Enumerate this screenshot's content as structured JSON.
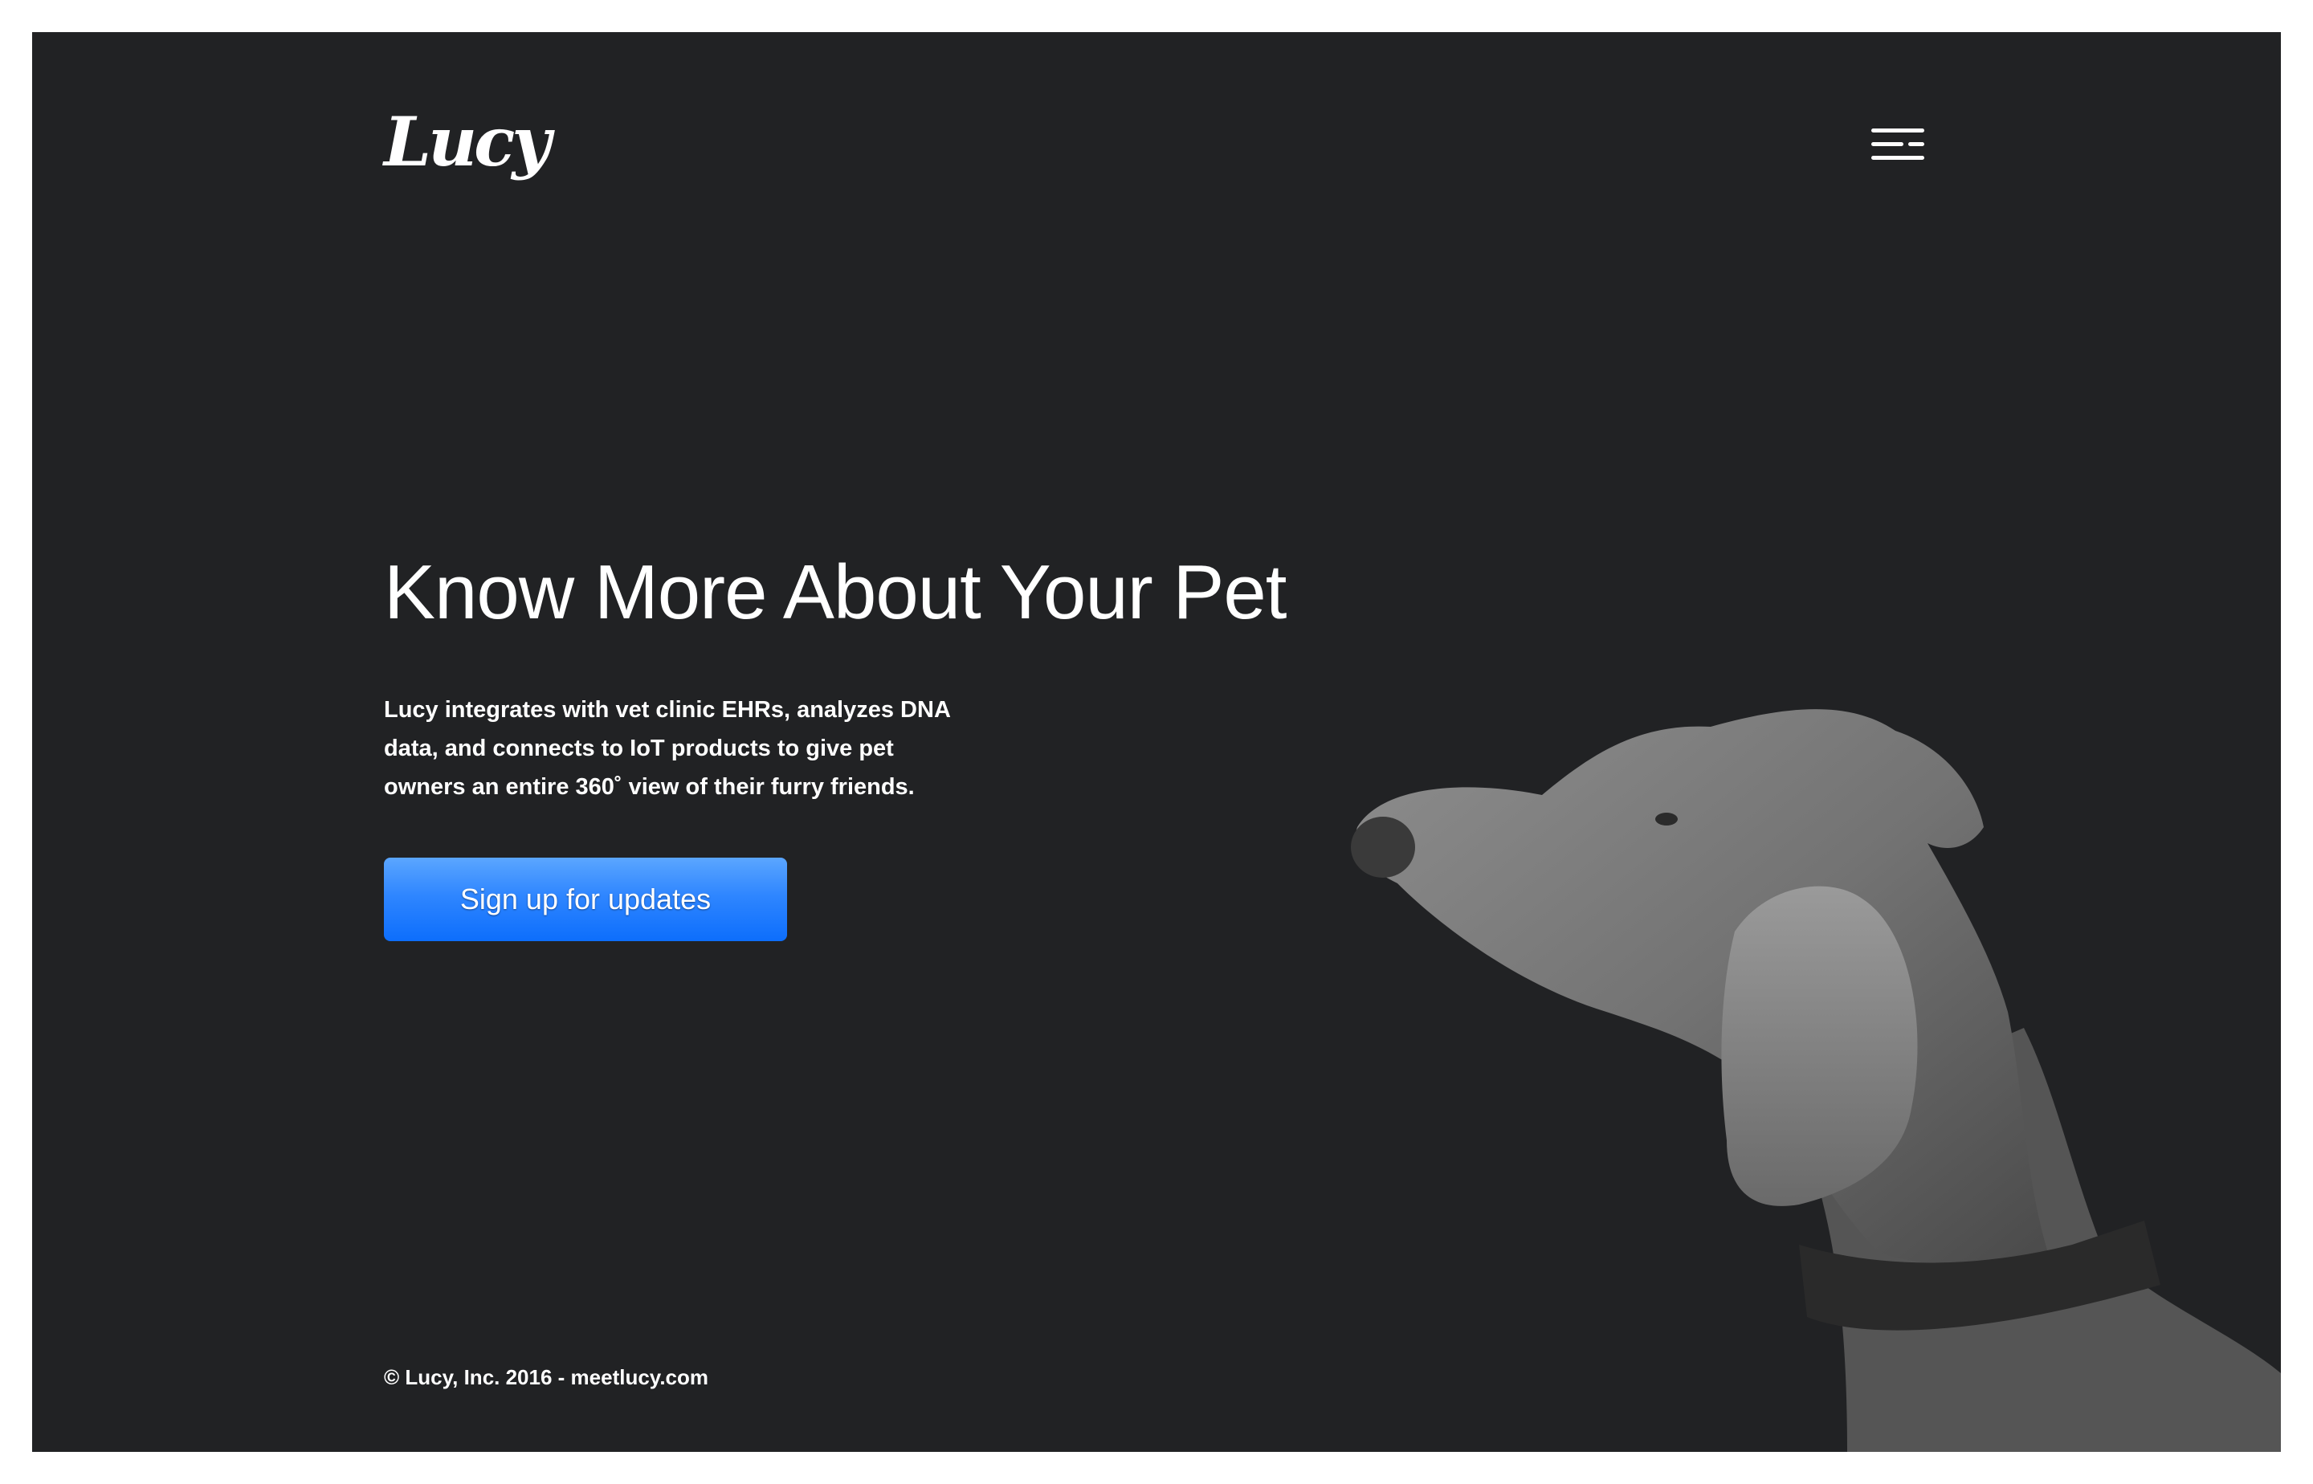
{
  "brand": {
    "logo_text": "Lucy"
  },
  "header": {
    "menu_icon": "hamburger-menu-icon"
  },
  "hero": {
    "headline": "Know More About Your Pet",
    "description": "Lucy integrates with vet clinic EHRs, analyzes DNA data, and connects to IoT products to give pet owners an entire 360˚ view of their furry friends.",
    "cta_label": "Sign up for updates"
  },
  "footer": {
    "text": "© Lucy, Inc. 2016 - meetlucy.com"
  },
  "colors": {
    "background": "#212224",
    "text": "#ffffff",
    "accent": "#1a7bff"
  }
}
